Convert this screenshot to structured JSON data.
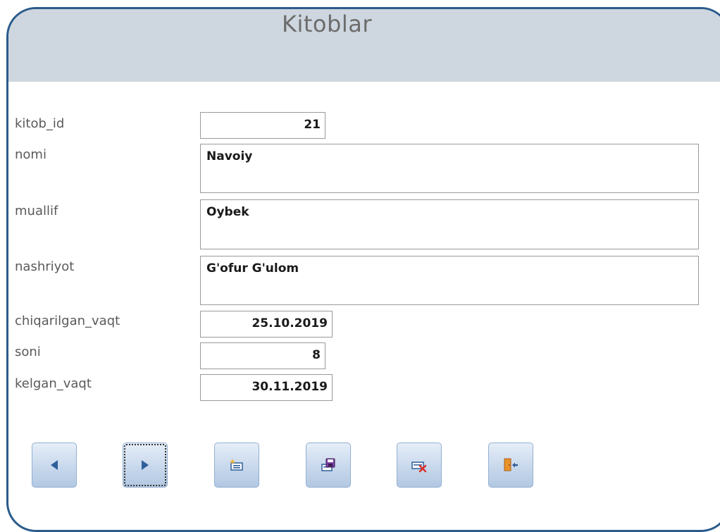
{
  "form": {
    "title": "Kitoblar"
  },
  "fields": {
    "kitob_id": {
      "label": "kitob_id",
      "value": "21"
    },
    "nomi": {
      "label": "nomi",
      "value": "Navoiy"
    },
    "muallif": {
      "label": "muallif",
      "value": "Oybek"
    },
    "nashriyot": {
      "label": "nashriyot",
      "value": "G'ofur G'ulom"
    },
    "chiqarilgan_vaqt": {
      "label": "chiqarilgan_vaqt",
      "value": "25.10.2019"
    },
    "soni": {
      "label": "soni",
      "value": "8"
    },
    "kelgan_vaqt": {
      "label": "kelgan_vaqt",
      "value": "30.11.2019"
    }
  },
  "buttons": [
    {
      "name": "previous-record-button",
      "icon": "triangle-left-icon"
    },
    {
      "name": "next-record-button",
      "icon": "triangle-right-icon"
    },
    {
      "name": "new-record-button",
      "icon": "new-record-icon"
    },
    {
      "name": "save-record-button",
      "icon": "save-disk-icon"
    },
    {
      "name": "delete-record-button",
      "icon": "delete-record-icon"
    },
    {
      "name": "close-form-button",
      "icon": "exit-door-icon"
    }
  ],
  "colors": {
    "header_bg": "#ced6df",
    "frame_border": "#2a5b8c",
    "button_bg": "#c8d8ec",
    "icon_blue": "#2f5f9a",
    "delete_red": "#d9302c",
    "door_orange": "#e8932a"
  }
}
